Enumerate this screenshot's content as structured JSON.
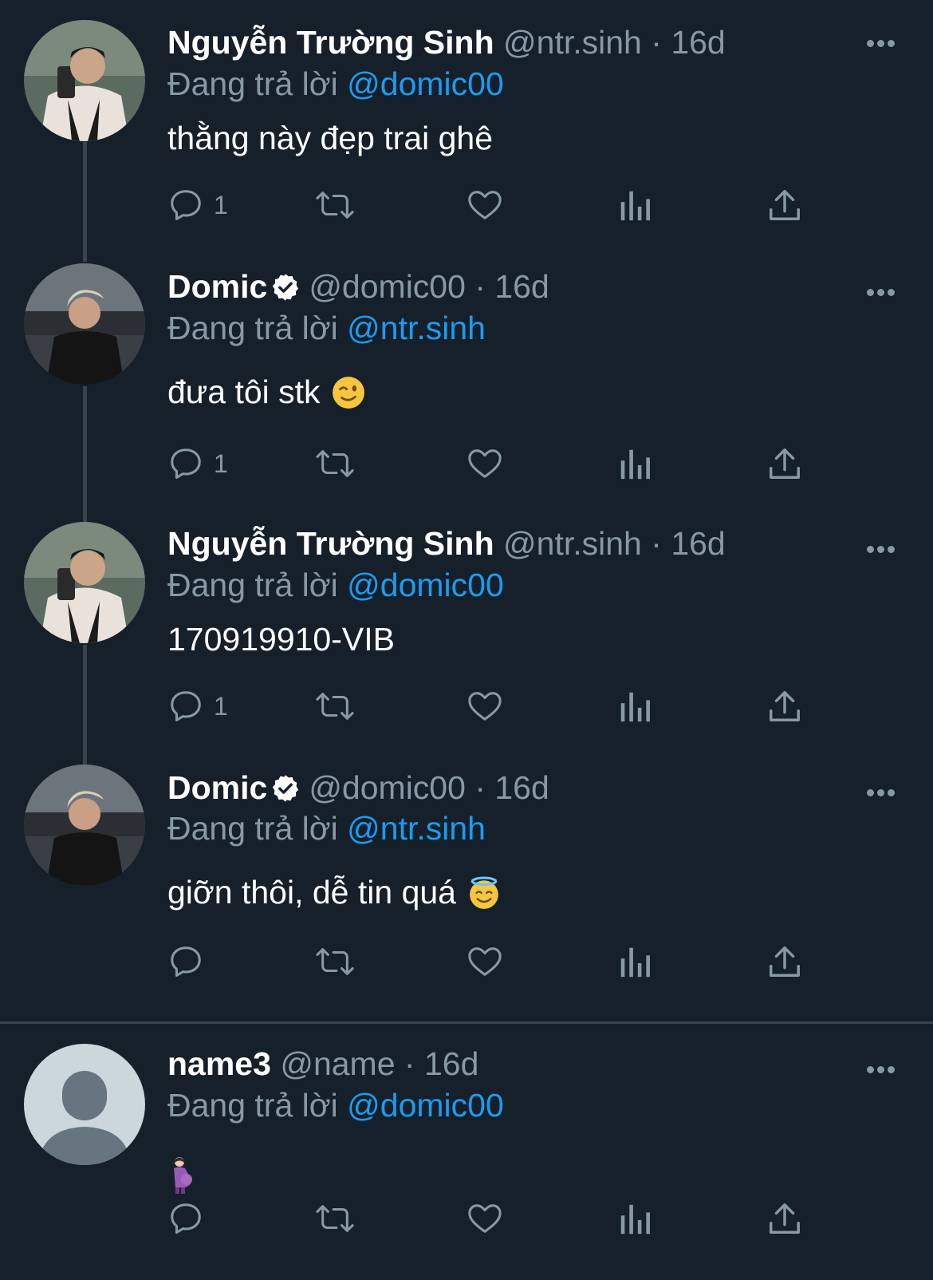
{
  "tweets": [
    {
      "name": "Nguyễn Trường Sinh",
      "handle": "@ntr.sinh",
      "separator": "·",
      "time": "16d",
      "verified": false,
      "reply_prefix": "Đang trả lời",
      "reply_to": "@domic00",
      "text": "thằng này đẹp trai ghê",
      "reply_count": "1"
    },
    {
      "name": "Domic",
      "handle": "@domic00",
      "separator": "·",
      "time": "16d",
      "verified": true,
      "reply_prefix": "Đang trả lời",
      "reply_to": "@ntr.sinh",
      "text": "đưa tôi stk",
      "emoji": "winking-face",
      "reply_count": "1"
    },
    {
      "name": "Nguyễn Trường Sinh",
      "handle": "@ntr.sinh",
      "separator": "·",
      "time": "16d",
      "verified": false,
      "reply_prefix": "Đang trả lời",
      "reply_to": "@domic00",
      "text": "170919910-VIB",
      "reply_count": "1"
    },
    {
      "name": "Domic",
      "handle": "@domic00",
      "separator": "·",
      "time": "16d",
      "verified": true,
      "reply_prefix": "Đang trả lời",
      "reply_to": "@ntr.sinh",
      "text": "giỡn thôi, dễ tin quá",
      "emoji": "smiling-face-with-halo",
      "reply_count": ""
    },
    {
      "name": "name3",
      "handle": "@name",
      "separator": "·",
      "time": "16d",
      "verified": false,
      "reply_prefix": "Đang trả lời",
      "reply_to": "@domic00",
      "text": "",
      "emoji": "pregnant-woman",
      "reply_count": ""
    }
  ],
  "colors": {
    "background": "#15202b",
    "secondary_text": "#8899a6",
    "link": "#1d9bf0",
    "divider": "#38444d"
  }
}
